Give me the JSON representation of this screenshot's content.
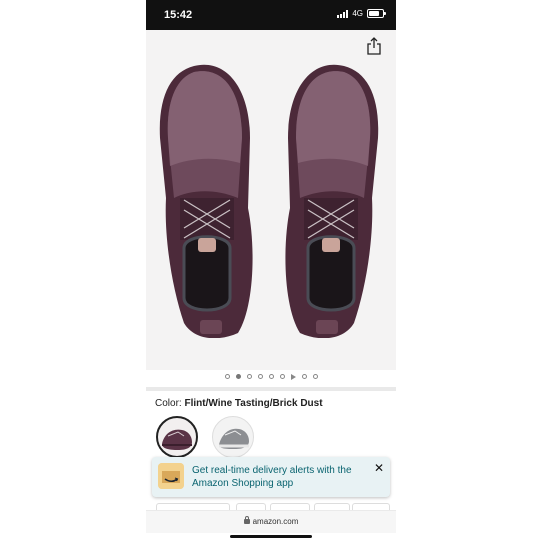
{
  "status_bar": {
    "time": "15:42",
    "network": "4G",
    "battery_level": 0.75
  },
  "product_gallery": {
    "dot_count": 9,
    "active_dot": 1,
    "icons": [
      "share-icon"
    ]
  },
  "color_selector": {
    "label": "Color:",
    "selected_value": "Flint/Wine Tasting/Brick Dust"
  },
  "notification_banner": {
    "text": "Get real-time delivery alerts with the Amazon Shopping app",
    "close_label": "✕",
    "accent_color": "#0a6470"
  },
  "browser": {
    "url": "amazon.com"
  }
}
